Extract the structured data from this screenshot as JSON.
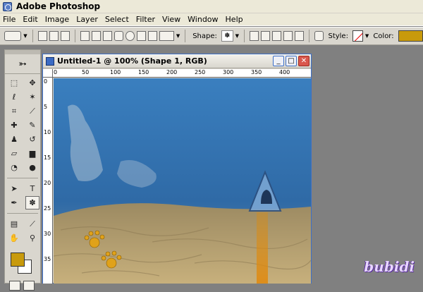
{
  "app": {
    "title": "Adobe Photoshop",
    "icon": "photoshop-icon"
  },
  "menu": [
    "File",
    "Edit",
    "Image",
    "Layer",
    "Select",
    "Filter",
    "View",
    "Window",
    "Help"
  ],
  "options": {
    "shape_label": "Shape:",
    "style_label": "Style:",
    "color_label": "Color:",
    "color_value": "#c89a0c"
  },
  "document": {
    "title": "Untitled-1 @ 100% (Shape 1, RGB)"
  },
  "ruler": {
    "top": [
      "0",
      "50",
      "100",
      "150",
      "200",
      "250",
      "300",
      "350",
      "400"
    ],
    "left": [
      "0",
      "5",
      "10",
      "15",
      "20",
      "25",
      "30",
      "35"
    ]
  },
  "colors": {
    "foreground": "#c89a0c",
    "background": "#ffffff",
    "sea": "#2f6fae",
    "sand": "#b59d6a"
  },
  "watermark": "bubidi"
}
